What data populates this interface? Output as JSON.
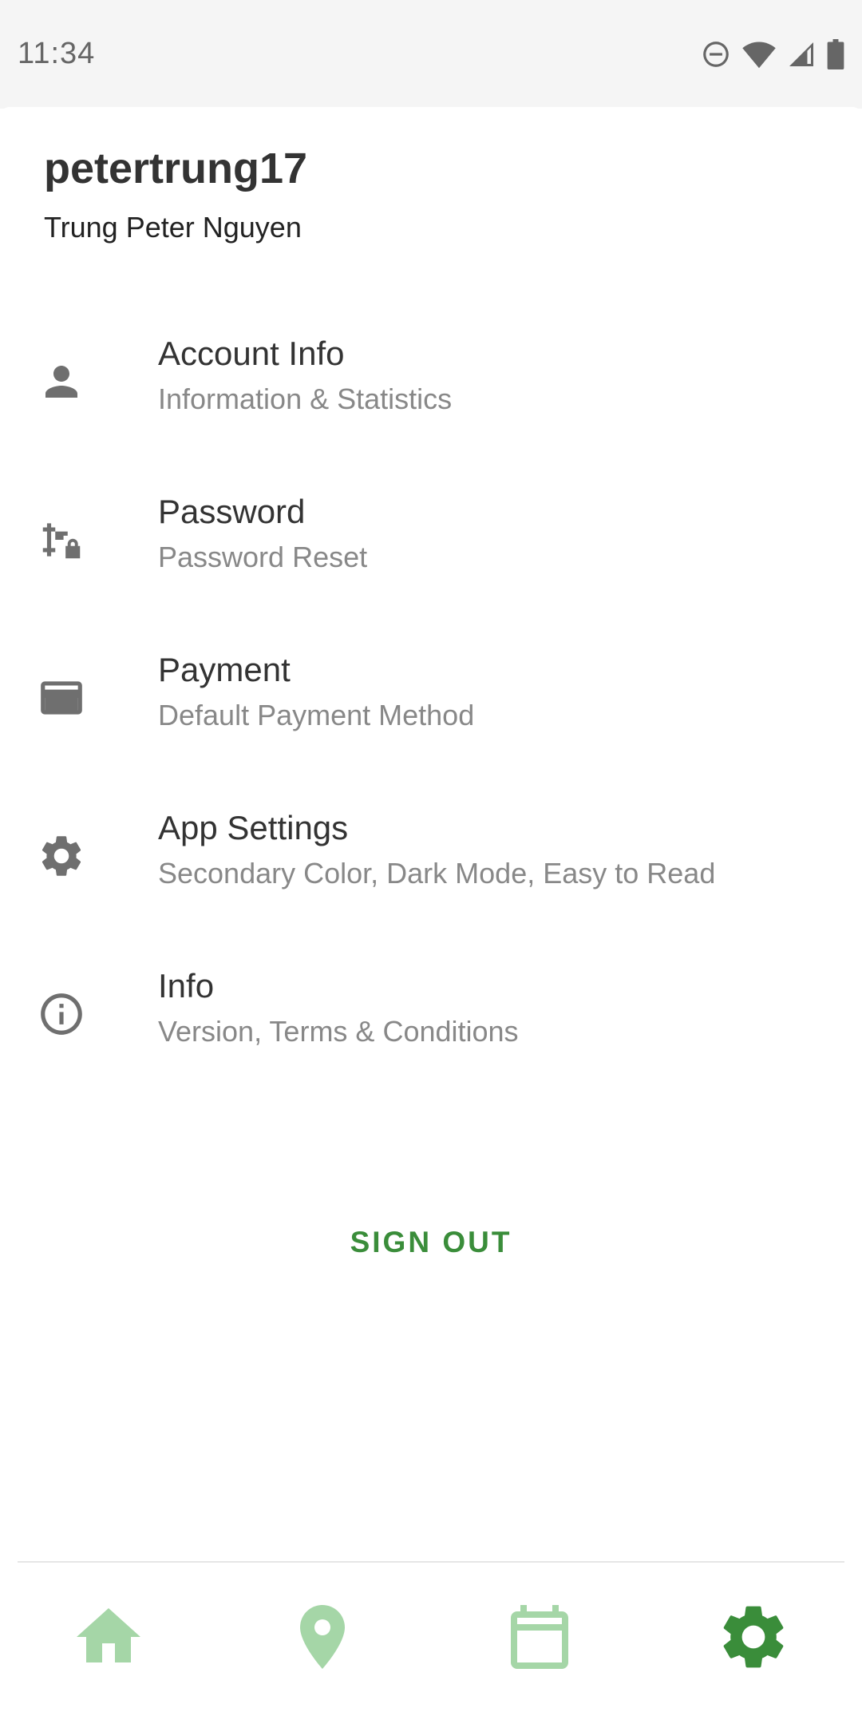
{
  "status_bar": {
    "time": "11:34",
    "icons": [
      "do-not-disturb-icon",
      "wifi-icon",
      "cell-signal-icon",
      "battery-icon"
    ]
  },
  "profile": {
    "username": "petertrung17",
    "full_name": "Trung Peter Nguyen"
  },
  "menu": [
    {
      "icon": "person-icon",
      "title": "Account Info",
      "subtitle": "Information & Statistics"
    },
    {
      "icon": "password-lock-icon",
      "title": "Password",
      "subtitle": "Password Reset"
    },
    {
      "icon": "credit-card-icon",
      "title": "Payment",
      "subtitle": "Default Payment Method"
    },
    {
      "icon": "gear-icon",
      "title": "App Settings",
      "subtitle": "Secondary Color, Dark Mode, Easy to Read"
    },
    {
      "icon": "info-icon",
      "title": "Info",
      "subtitle": "Version, Terms & Conditions"
    }
  ],
  "sign_out_label": "SIGN OUT",
  "bottom_nav": {
    "items": [
      "home-icon",
      "location-pin-icon",
      "calendar-icon",
      "settings-gear-icon"
    ],
    "active": "settings-gear-icon",
    "active_color": "#3a8d3a",
    "inactive_color": "#a5d6a7"
  },
  "colors": {
    "accent": "#3a8d3a",
    "icon_gray": "#6f6f6f",
    "subtitle_gray": "#888888"
  }
}
